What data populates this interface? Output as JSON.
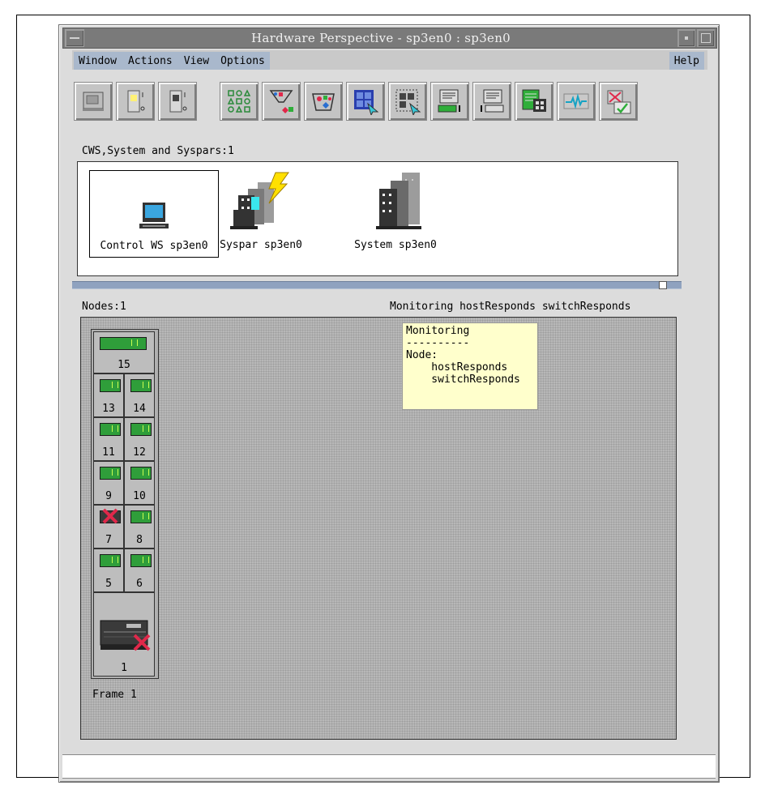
{
  "window": {
    "title": "Hardware Perspective - sp3en0 : sp3en0"
  },
  "menubar": {
    "items": [
      "Window",
      "Actions",
      "View",
      "Options"
    ],
    "help": "Help"
  },
  "toolbar": {
    "tools": [
      {
        "icon": "workstation-icon"
      },
      {
        "icon": "node-light-icon"
      },
      {
        "icon": "node-dark-icon"
      },
      {
        "icon": "shapes-grid-icon"
      },
      {
        "icon": "filter-funnel-icon"
      },
      {
        "icon": "filter-basket-icon"
      },
      {
        "icon": "grid-select-icon"
      },
      {
        "icon": "grid-dotted-icon"
      },
      {
        "icon": "panel-terminal-icon"
      },
      {
        "icon": "panel-keyboard-icon"
      },
      {
        "icon": "table-edit-icon"
      },
      {
        "icon": "monitor-pulse-icon"
      },
      {
        "icon": "delete-check-icon"
      }
    ]
  },
  "top_panel": {
    "label": "CWS,System and Syspars:1",
    "objects": [
      {
        "label": "Control WS sp3en0",
        "icon": "computer-icon",
        "selected": true
      },
      {
        "label": "Syspar sp3en0",
        "icon": "syspar-icon"
      },
      {
        "label": "System sp3en0",
        "icon": "system-icon"
      }
    ]
  },
  "bottom_panel": {
    "label": "Nodes:1",
    "monitoring_label": "Monitoring hostResponds switchResponds",
    "tooltip": "Monitoring\n----------\nNode:\n    hostResponds\n    switchResponds",
    "frame": {
      "label": "Frame 1",
      "wide_node": {
        "number": "15"
      },
      "nodes": [
        {
          "left": "13",
          "right": "14"
        },
        {
          "left": "11",
          "right": "12"
        },
        {
          "left": "9",
          "right": "10"
        },
        {
          "left": "7",
          "right": "8"
        },
        {
          "left": "5",
          "right": "6"
        }
      ],
      "failed_nodes": [
        "7",
        "1"
      ],
      "bottom_node": {
        "number": "1"
      }
    }
  },
  "colors": {
    "titlebar": "#7a7a7a",
    "menu_highlight": "#a9b8cc",
    "node_green": "#2f9e3a",
    "failure_red": "#e0284a",
    "tooltip_bg": "#ffffcc"
  }
}
